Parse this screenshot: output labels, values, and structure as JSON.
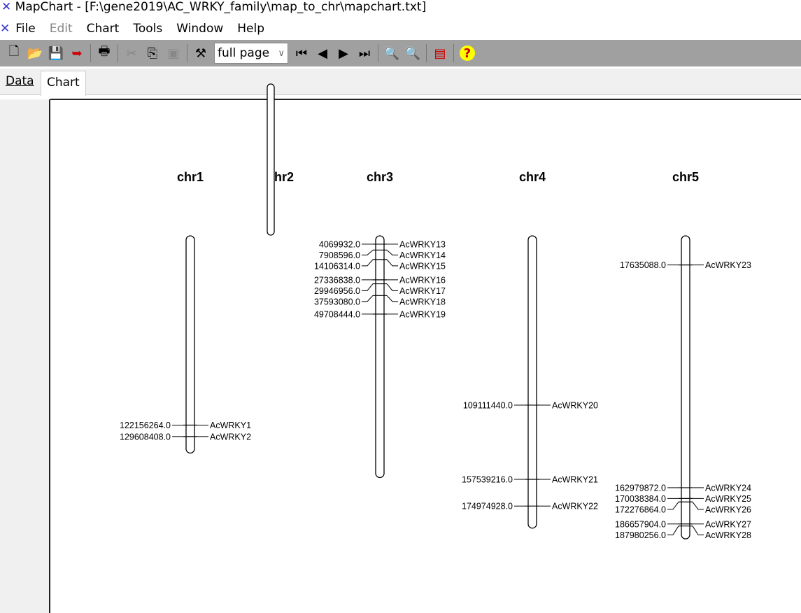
{
  "window": {
    "title": "MapChart - [F:\\gene2019\\AC_WRKY_family\\map_to_chr\\mapchart.txt]"
  },
  "menu": {
    "items": [
      "File",
      "Edit",
      "Chart",
      "Tools",
      "Window",
      "Help"
    ],
    "disabled": [
      "Edit"
    ]
  },
  "toolbar": {
    "zoom_value": "full page",
    "icons": [
      "new-icon",
      "open-icon",
      "save-icon",
      "export-icon",
      "print-icon",
      "cut-icon",
      "copy-icon",
      "paste-icon",
      "tools-icon",
      "first-icon",
      "prev-icon",
      "next-icon",
      "last-icon",
      "zoom-out-icon",
      "zoom-in-icon",
      "chart-options-icon",
      "help-icon"
    ]
  },
  "tabs": [
    {
      "label": "Data"
    },
    {
      "label": "Chart",
      "active": true
    }
  ],
  "chart_data": {
    "type": "chromosome-map",
    "chromosomes": [
      {
        "name": "chr1",
        "length": 139000000,
        "genes": [
          {
            "pos": "122156264.0",
            "name": "AcWRKY1"
          },
          {
            "pos": "129608408.0",
            "name": "AcWRKY2"
          }
        ]
      },
      {
        "name": "chr2",
        "length": null,
        "genes": []
      },
      {
        "name": "chr3",
        "length": 155000000,
        "genes": [
          {
            "pos": "4069932.0",
            "name": "AcWRKY13"
          },
          {
            "pos": "7908596.0",
            "name": "AcWRKY14"
          },
          {
            "pos": "14106314.0",
            "name": "AcWRKY15"
          },
          {
            "pos": "27336838.0",
            "name": "AcWRKY16"
          },
          {
            "pos": "29946956.0",
            "name": "AcWRKY17"
          },
          {
            "pos": "37593080.0",
            "name": "AcWRKY18"
          },
          {
            "pos": "49708444.0",
            "name": "AcWRKY19"
          }
        ]
      },
      {
        "name": "chr4",
        "length": 188000000,
        "genes": [
          {
            "pos": "109111440.0",
            "name": "AcWRKY20"
          },
          {
            "pos": "157539216.0",
            "name": "AcWRKY21"
          },
          {
            "pos": "174974928.0",
            "name": "AcWRKY22"
          }
        ]
      },
      {
        "name": "chr5",
        "length": 195000000,
        "genes": [
          {
            "pos": "17635088.0",
            "name": "AcWRKY23"
          },
          {
            "pos": "162979872.0",
            "name": "AcWRKY24"
          },
          {
            "pos": "170038384.0",
            "name": "AcWRKY25"
          },
          {
            "pos": "172276864.0",
            "name": "AcWRKY26"
          },
          {
            "pos": "186657904.0",
            "name": "AcWRKY27"
          },
          {
            "pos": "187980256.0",
            "name": "AcWRKY28"
          }
        ]
      }
    ]
  }
}
